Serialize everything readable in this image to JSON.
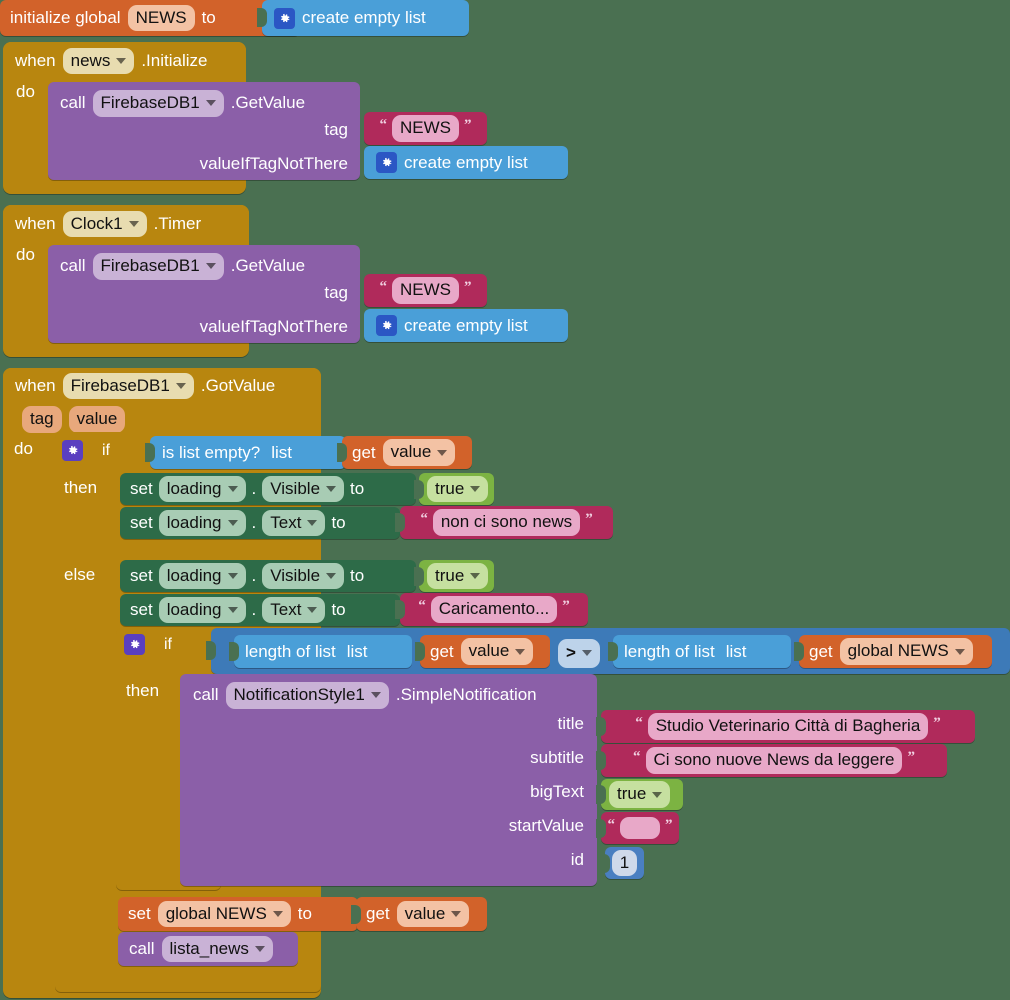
{
  "editor": {
    "name": "MIT App Inventor Blocks Editor",
    "canvas_background": "#4a7051"
  },
  "colors": {
    "variable": "#d2622a",
    "event": "#b8860f",
    "control": "#b8860f",
    "procedure_call": "#8b5fa8",
    "text": "#b02a5b",
    "list": "#4a9fd8",
    "logic": "#7cb342",
    "component_set": "#2d6b48",
    "math": "#4a7fc1",
    "logic_compare": "#3d7ab8"
  },
  "blocks": {
    "global_init": {
      "keyword": "initialize global",
      "name": "NEWS",
      "to": "to",
      "value_label": "create empty list",
      "gear_icon": "gear-icon"
    },
    "news_initialize": {
      "when": "when",
      "component": "news",
      "event": ".Initialize",
      "do": "do",
      "call": {
        "call": "call",
        "component": "FirebaseDB1",
        "method": ".GetValue",
        "args": [
          {
            "name": "tag",
            "type": "text",
            "value": "NEWS"
          },
          {
            "name": "valueIfTagNotThere",
            "type": "list",
            "value": "create empty list"
          }
        ]
      }
    },
    "clock_timer": {
      "when": "when",
      "component": "Clock1",
      "event": ".Timer",
      "do": "do",
      "call": {
        "call": "call",
        "component": "FirebaseDB1",
        "method": ".GetValue",
        "args": [
          {
            "name": "tag",
            "type": "text",
            "value": "NEWS"
          },
          {
            "name": "valueIfTagNotThere",
            "type": "list",
            "value": "create empty list"
          }
        ]
      }
    },
    "got_value": {
      "when": "when",
      "component": "FirebaseDB1",
      "event": ".GotValue",
      "params": [
        "tag",
        "value"
      ],
      "do": "do",
      "if_label": "if",
      "then_label": "then",
      "else_label": "else",
      "condition": {
        "list_op": "is list empty?",
        "list_label": "list",
        "get": "get",
        "variable": "value"
      },
      "then_branch": [
        {
          "set": "set",
          "component": "loading",
          "dot": ".",
          "property": "Visible",
          "to": "to",
          "value_type": "logic",
          "value": "true"
        },
        {
          "set": "set",
          "component": "loading",
          "dot": ".",
          "property": "Text",
          "to": "to",
          "value_type": "text",
          "value": "non ci sono news"
        }
      ],
      "else_branch": [
        {
          "set": "set",
          "component": "loading",
          "dot": ".",
          "property": "Visible",
          "to": "to",
          "value_type": "logic",
          "value": "true"
        },
        {
          "set": "set",
          "component": "loading",
          "dot": ".",
          "property": "Text",
          "to": "to",
          "value_type": "text",
          "value": "Caricamento..."
        }
      ],
      "inner_if": {
        "if_label": "if",
        "then_label": "then",
        "left": {
          "list_op": "length of list",
          "list_label": "list",
          "get": "get",
          "variable": "value"
        },
        "operator": ">",
        "right": {
          "list_op": "length of list",
          "list_label": "list",
          "get": "get",
          "variable": "global NEWS"
        },
        "notification": {
          "call": "call",
          "component": "NotificationStyle1",
          "method": ".SimpleNotification",
          "args": [
            {
              "name": "title",
              "type": "text",
              "value": "Studio Veterinario Città di Bagheria"
            },
            {
              "name": "subtitle",
              "type": "text",
              "value": "Ci sono nuove News da leggere"
            },
            {
              "name": "bigText",
              "type": "logic",
              "value": "true"
            },
            {
              "name": "startValue",
              "type": "text",
              "value": ""
            },
            {
              "name": "id",
              "type": "math",
              "value": "1"
            }
          ]
        }
      },
      "tail": [
        {
          "set": "set",
          "variable": "global NEWS",
          "to": "to",
          "get": "get",
          "value": "value"
        },
        {
          "call": "call",
          "procedure": "lista_news"
        }
      ]
    }
  }
}
